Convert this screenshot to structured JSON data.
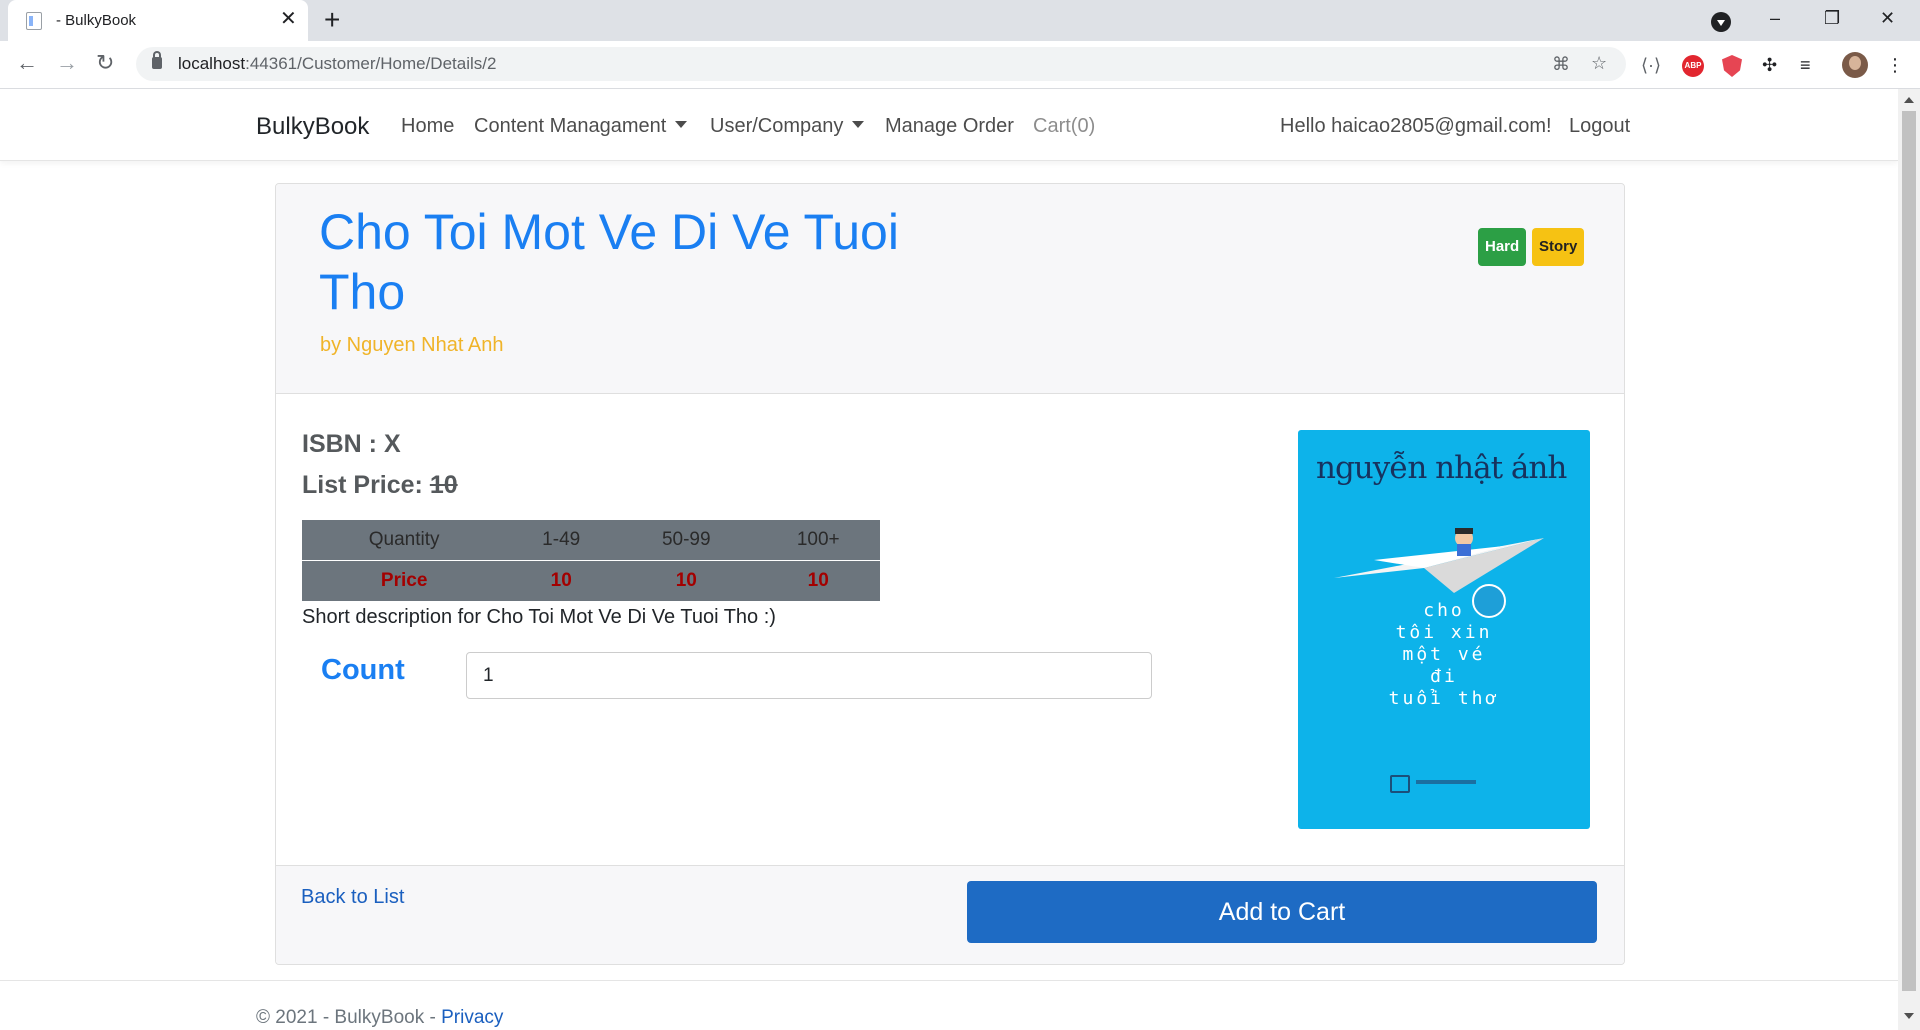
{
  "browser": {
    "tab_title": "- BulkyBook",
    "tab_close": "✕",
    "new_tab": "+",
    "url_host": "localhost",
    "url_path": ":44361/Customer/Home/Details/2",
    "window_controls": [
      "–",
      "❐",
      "✕"
    ]
  },
  "navbar": {
    "brand": "BulkyBook",
    "links": [
      "Home",
      "Content Managament",
      "User/Company",
      "Manage Order",
      "Cart(0)"
    ],
    "greeting": "Hello haicao2805@gmail.com!",
    "logout": "Logout"
  },
  "product": {
    "title": "Cho Toi Mot Ve Di Ve Tuoi Tho",
    "author": "by Nguyen Nhat Anh",
    "badges": [
      "Hard",
      "Story"
    ],
    "isbn": "ISBN : X",
    "list_price_label": "List Price:",
    "list_price": "10",
    "price_table": {
      "headers": [
        "Quantity",
        "1-49",
        "50-99",
        "100+"
      ],
      "row": [
        "Price",
        "10",
        "10",
        "10"
      ]
    },
    "short_description": "Short description for Cho Toi Mot Ve Di Ve Tuoi Tho :)",
    "count_label": "Count",
    "count_value": "1",
    "cover": {
      "author_text": "nguyễn nhật ánh",
      "title_text": "cho\ntôi xin\nmột vé\nđi\ntuổi thơ"
    }
  },
  "actions": {
    "back": "Back to List",
    "add_to_cart": "Add to Cart"
  },
  "footer": {
    "copyright": "© 2021 - BulkyBook - ",
    "privacy": "Privacy"
  },
  "colors": {
    "primary": "#1a7ff2",
    "author": "#f0b429",
    "badge_hard": "#2c9f45",
    "badge_story": "#f6c213",
    "price_text": "#a30000",
    "button": "#1e6bc4"
  }
}
